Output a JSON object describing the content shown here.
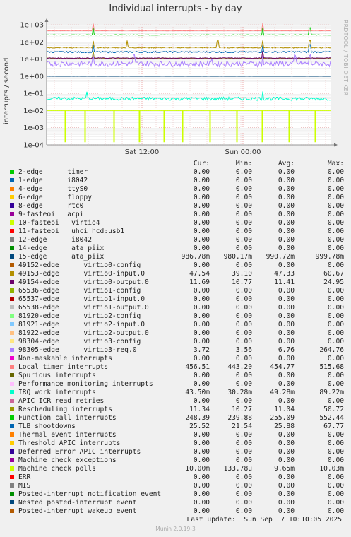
{
  "title": "Individual interrupts - by day",
  "side_label": "RRDTOOL / TOBI OETIKER",
  "footer": {
    "last_update": "Last update:  Sun Sep  7 10:10:05 2025",
    "munin": "Munin 2.0.19-3"
  },
  "legend_headers": [
    "Cur:",
    "Min:",
    "Avg:",
    "Max:"
  ],
  "chart_data": {
    "type": "line",
    "title": "Individual interrupts - by day",
    "ylabel": "interrupts / second",
    "yscale": "log",
    "ylim": [
      0.0001,
      1000
    ],
    "yticks": [
      "1e-04",
      "1e-03",
      "1e-02",
      "1e-01",
      "1e+00",
      "1e+01",
      "1e+02",
      "1e+03"
    ],
    "xticks": [
      "Sat 12:00",
      "Sun 00:00"
    ],
    "grid": true,
    "series": [
      {
        "name": "2-edge      timer",
        "color": "#00cc00",
        "cur": "0.00",
        "min": "0.00",
        "avg": "0.00",
        "max": "0.00"
      },
      {
        "name": "1-edge      i8042",
        "color": "#0066b3",
        "cur": "0.00",
        "min": "0.00",
        "avg": "0.00",
        "max": "0.00"
      },
      {
        "name": "4-edge      ttyS0",
        "color": "#ff8000",
        "cur": "0.00",
        "min": "0.00",
        "avg": "0.00",
        "max": "0.00"
      },
      {
        "name": "6-edge      floppy",
        "color": "#ffcc00",
        "cur": "0.00",
        "min": "0.00",
        "avg": "0.00",
        "max": "0.00"
      },
      {
        "name": "8-edge      rtc0",
        "color": "#330099",
        "cur": "0.00",
        "min": "0.00",
        "avg": "0.00",
        "max": "0.00"
      },
      {
        "name": "9-fasteoi   acpi",
        "color": "#990099",
        "cur": "0.00",
        "min": "0.00",
        "avg": "0.00",
        "max": "0.00"
      },
      {
        "name": "10-fasteoi   virtio4",
        "color": "#ccff00",
        "cur": "0.00",
        "min": "0.00",
        "avg": "0.00",
        "max": "0.00"
      },
      {
        "name": "11-fasteoi   uhci_hcd:usb1",
        "color": "#ff0000",
        "cur": "0.00",
        "min": "0.00",
        "avg": "0.00",
        "max": "0.00"
      },
      {
        "name": "12-edge      i8042",
        "color": "#808080",
        "cur": "0.00",
        "min": "0.00",
        "avg": "0.00",
        "max": "0.00"
      },
      {
        "name": "14-edge      ata_piix",
        "color": "#008f00",
        "cur": "0.00",
        "min": "0.00",
        "avg": "0.00",
        "max": "0.00"
      },
      {
        "name": "15-edge      ata_piix",
        "color": "#00487d",
        "cur": "986.78m",
        "min": "980.17m",
        "avg": "990.72m",
        "max": "999.78m"
      },
      {
        "name": "49152-edge      virtio0-config",
        "color": "#b35a00",
        "cur": "0.00",
        "min": "0.00",
        "avg": "0.00",
        "max": "0.00"
      },
      {
        "name": "49153-edge      virtio0-input.0",
        "color": "#b38f00",
        "cur": "47.54",
        "min": "39.10",
        "avg": "47.33",
        "max": "60.67"
      },
      {
        "name": "49154-edge      virtio0-output.0",
        "color": "#6b006b",
        "cur": "11.69",
        "min": "10.77",
        "avg": "11.41",
        "max": "24.95"
      },
      {
        "name": "65536-edge      virtio1-config",
        "color": "#8fb300",
        "cur": "0.00",
        "min": "0.00",
        "avg": "0.00",
        "max": "0.00"
      },
      {
        "name": "65537-edge      virtio1-input.0",
        "color": "#b30000",
        "cur": "0.00",
        "min": "0.00",
        "avg": "0.00",
        "max": "0.00"
      },
      {
        "name": "65538-edge      virtio1-output.0",
        "color": "#bebebe",
        "cur": "0.00",
        "min": "0.00",
        "avg": "0.00",
        "max": "0.00"
      },
      {
        "name": "81920-edge      virtio2-config",
        "color": "#80ff80",
        "cur": "0.00",
        "min": "0.00",
        "avg": "0.00",
        "max": "0.00"
      },
      {
        "name": "81921-edge      virtio2-input.0",
        "color": "#80c9ff",
        "cur": "0.00",
        "min": "0.00",
        "avg": "0.00",
        "max": "0.00"
      },
      {
        "name": "81922-edge      virtio2-output.0",
        "color": "#ffc080",
        "cur": "0.00",
        "min": "0.00",
        "avg": "0.00",
        "max": "0.00"
      },
      {
        "name": "98304-edge      virtio3-config",
        "color": "#ffe680",
        "cur": "0.00",
        "min": "0.00",
        "avg": "0.00",
        "max": "0.00"
      },
      {
        "name": "98305-edge      virtio3-req.0",
        "color": "#aa80ff",
        "cur": "3.72",
        "min": "3.56",
        "avg": "6.76",
        "max": "264.76"
      },
      {
        "name": "Non-maskable interrupts",
        "color": "#ee00cc",
        "cur": "0.00",
        "min": "0.00",
        "avg": "0.00",
        "max": "0.00"
      },
      {
        "name": "Local timer interrupts",
        "color": "#ff8080",
        "cur": "456.51",
        "min": "443.20",
        "avg": "454.77",
        "max": "515.68"
      },
      {
        "name": "Spurious interrupts",
        "color": "#666600",
        "cur": "0.00",
        "min": "0.00",
        "avg": "0.00",
        "max": "0.00"
      },
      {
        "name": "Performance monitoring interrupts",
        "color": "#ffbfff",
        "cur": "0.00",
        "min": "0.00",
        "avg": "0.00",
        "max": "0.00"
      },
      {
        "name": "IRQ work interrupts",
        "color": "#00ffcc",
        "cur": "43.50m",
        "min": "30.28m",
        "avg": "49.28m",
        "max": "89.22m"
      },
      {
        "name": "APIC ICR read retries",
        "color": "#cc6699",
        "cur": "0.00",
        "min": "0.00",
        "avg": "0.00",
        "max": "0.00"
      },
      {
        "name": "Rescheduling interrupts",
        "color": "#999900",
        "cur": "11.34",
        "min": "10.27",
        "avg": "11.04",
        "max": "50.72"
      },
      {
        "name": "Function call interrupts",
        "color": "#00cc00",
        "cur": "248.39",
        "min": "239.88",
        "avg": "255.09",
        "max": "552.44"
      },
      {
        "name": "TLB shootdowns",
        "color": "#0066b3",
        "cur": "25.52",
        "min": "21.54",
        "avg": "25.88",
        "max": "67.77"
      },
      {
        "name": "Thermal event interrupts",
        "color": "#ff8000",
        "cur": "0.00",
        "min": "0.00",
        "avg": "0.00",
        "max": "0.00"
      },
      {
        "name": "Threshold APIC interrupts",
        "color": "#ffcc00",
        "cur": "0.00",
        "min": "0.00",
        "avg": "0.00",
        "max": "0.00"
      },
      {
        "name": "Deferred Error APIC interrupts",
        "color": "#330099",
        "cur": "0.00",
        "min": "0.00",
        "avg": "0.00",
        "max": "0.00"
      },
      {
        "name": "Machine check exceptions",
        "color": "#990099",
        "cur": "0.00",
        "min": "0.00",
        "avg": "0.00",
        "max": "0.00"
      },
      {
        "name": "Machine check polls",
        "color": "#ccff00",
        "cur": "10.00m",
        "min": "133.78u",
        "avg": "9.65m",
        "max": "10.03m"
      },
      {
        "name": "ERR",
        "color": "#ff0000",
        "cur": "0.00",
        "min": "0.00",
        "avg": "0.00",
        "max": "0.00"
      },
      {
        "name": "MIS",
        "color": "#808080",
        "cur": "0.00",
        "min": "0.00",
        "avg": "0.00",
        "max": "0.00"
      },
      {
        "name": "Posted-interrupt notification event",
        "color": "#008f00",
        "cur": "0.00",
        "min": "0.00",
        "avg": "0.00",
        "max": "0.00"
      },
      {
        "name": "Nested posted-interrupt event",
        "color": "#00487d",
        "cur": "0.00",
        "min": "0.00",
        "avg": "0.00",
        "max": "0.00"
      },
      {
        "name": "Posted-interrupt wakeup event",
        "color": "#b35a00",
        "cur": "0.00",
        "min": "0.00",
        "avg": "0.00",
        "max": "0.00"
      }
    ]
  }
}
